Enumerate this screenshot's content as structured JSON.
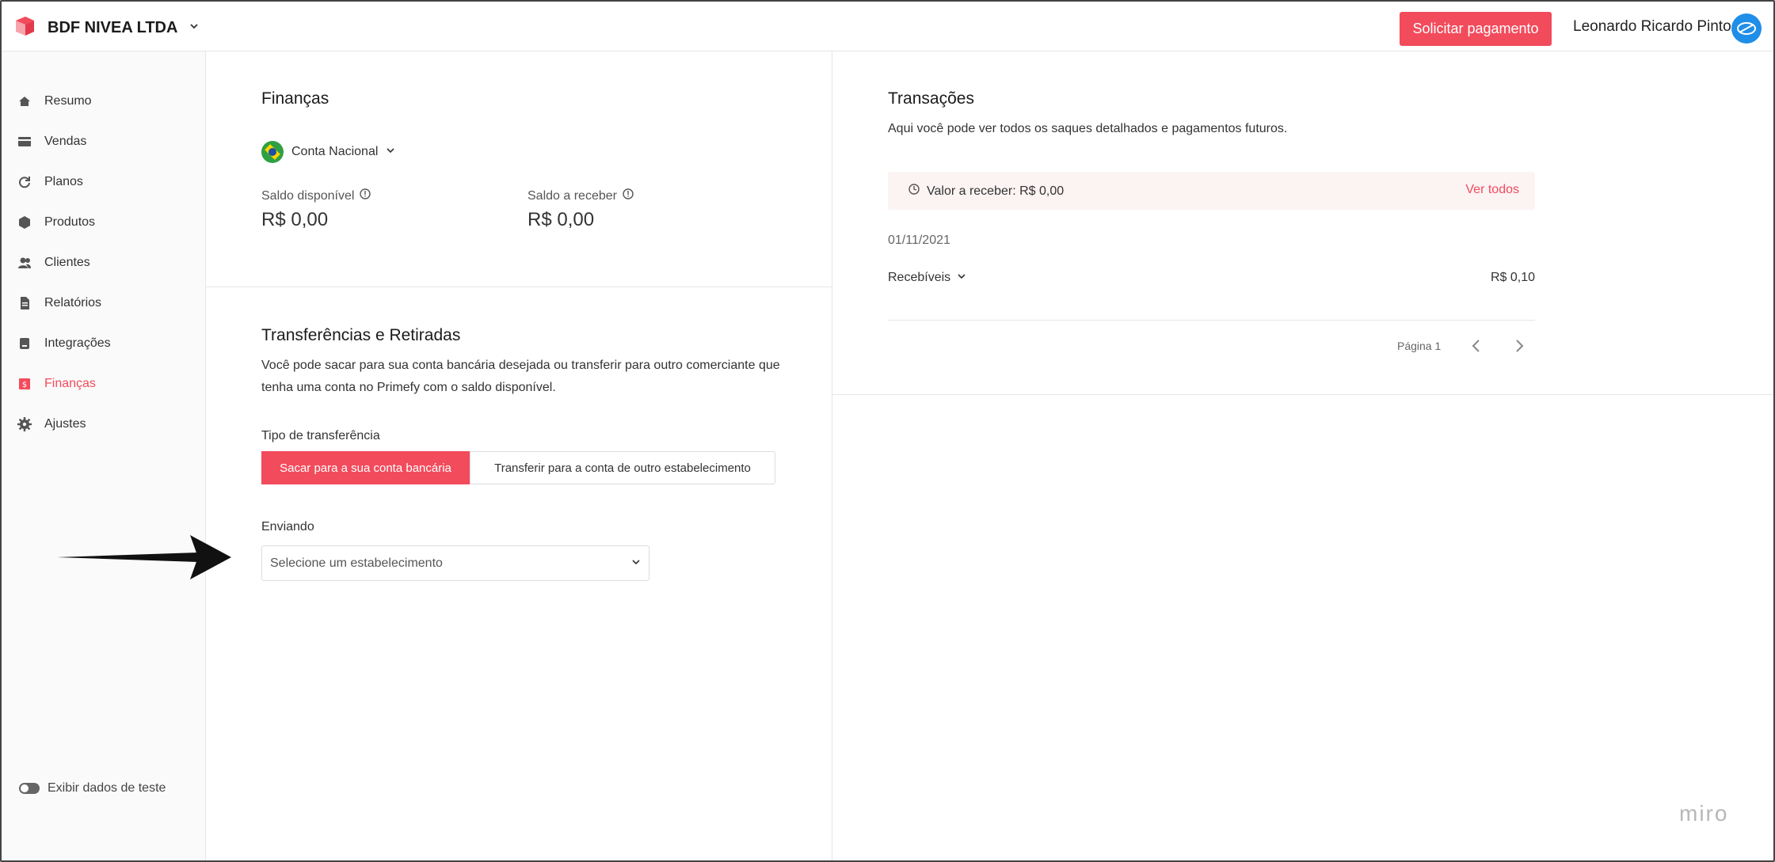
{
  "header": {
    "company": "BDF NIVEA LTDA",
    "request_payment": "Solicitar pagamento",
    "user_name": "Leonardo Ricardo Pinto"
  },
  "sidebar": {
    "items": [
      {
        "label": "Resumo",
        "icon": "home-icon"
      },
      {
        "label": "Vendas",
        "icon": "card-icon"
      },
      {
        "label": "Planos",
        "icon": "refresh-icon"
      },
      {
        "label": "Produtos",
        "icon": "box-icon"
      },
      {
        "label": "Clientes",
        "icon": "users-icon"
      },
      {
        "label": "Relatórios",
        "icon": "document-icon"
      },
      {
        "label": "Integrações",
        "icon": "plug-icon"
      },
      {
        "label": "Finanças",
        "icon": "finance-icon"
      },
      {
        "label": "Ajustes",
        "icon": "gear-icon"
      }
    ],
    "active": "Finanças",
    "test_toggle": "Exibir dados de teste"
  },
  "finance": {
    "title": "Finanças",
    "account": "Conta Nacional",
    "available_label": "Saldo disponível",
    "available_amount": "R$ 0,00",
    "receivable_label": "Saldo a receber",
    "receivable_amount": "R$ 0,00"
  },
  "transfers": {
    "title": "Transferências e Retiradas",
    "description_line1": "Você pode sacar para sua conta bancária desejada ou transferir para outro comerciante que",
    "description_line2": "tenha uma conta no Primefy com o saldo disponível.",
    "type_label": "Tipo de transferência",
    "option_bank": "Sacar para a sua conta bancária",
    "option_other": "Transferir para a conta de outro estabelecimento",
    "sending_label": "Enviando",
    "select_placeholder": "Selecione um estabelecimento"
  },
  "transactions": {
    "title": "Transações",
    "subtitle": "Aqui você pode ver todos os saques detalhados e pagamentos futuros.",
    "pending_text": "Valor a receber: R$ 0,00",
    "view_all": "Ver todos",
    "date": "01/11/2021",
    "group_label": "Recebíveis",
    "group_amount": "R$ 0,10",
    "page_label": "Página 1"
  },
  "watermark": "miro",
  "colors": {
    "accent": "#f24b5c",
    "avatar": "#1f8ee8",
    "pending_bg": "#fcf3f3"
  }
}
